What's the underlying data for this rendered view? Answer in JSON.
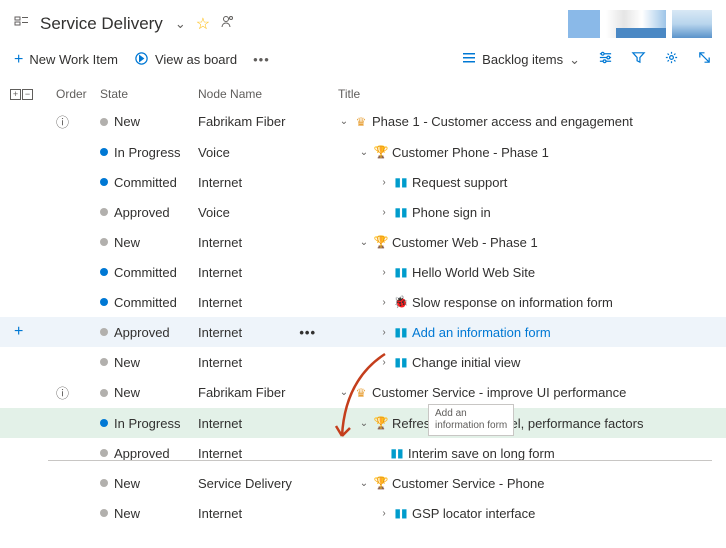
{
  "header": {
    "title": "Service Delivery"
  },
  "toolbar": {
    "new_item": "New Work Item",
    "view_board": "View as board",
    "backlog_sel": "Backlog items"
  },
  "columns": {
    "order": "Order",
    "state": "State",
    "node": "Node Name",
    "title": "Title"
  },
  "states": {
    "new": "New",
    "progress": "In Progress",
    "committed": "Committed",
    "approved": "Approved"
  },
  "nodes": {
    "fabrikam": "Fabrikam Fiber",
    "voice": "Voice",
    "internet": "Internet",
    "service": "Service Delivery"
  },
  "rows": [
    {
      "title": "Phase 1 - Customer access and engagement"
    },
    {
      "title": "Customer Phone - Phase 1"
    },
    {
      "title": "Request support"
    },
    {
      "title": "Phone sign in"
    },
    {
      "title": "Customer Web - Phase 1"
    },
    {
      "title": "Hello World Web Site"
    },
    {
      "title": "Slow response on information form"
    },
    {
      "title": "Add an information form"
    },
    {
      "title": "Change initial view"
    },
    {
      "title": "Customer Service - improve UI performance"
    },
    {
      "title": "Refresh web look, feel, performance factors"
    },
    {
      "title": "Interim save on long form"
    },
    {
      "title": "Customer Service - Phone"
    },
    {
      "title": "GSP locator interface"
    }
  ],
  "tooltip": {
    "line1": "Add an",
    "line2": "information form"
  }
}
